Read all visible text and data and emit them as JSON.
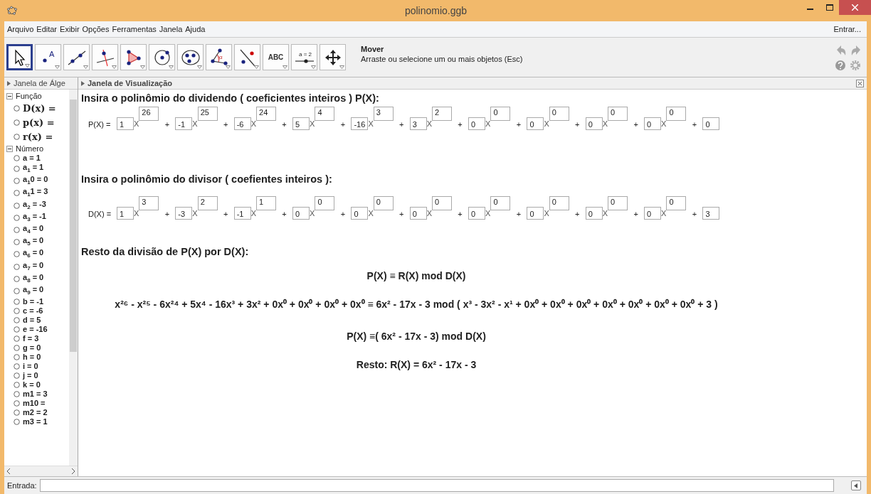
{
  "window": {
    "title": "polinomio.ggb"
  },
  "menu": [
    "Arquivo",
    "Editar",
    "Exibir",
    "Opções",
    "Ferramentas",
    "Janela",
    "Ajuda"
  ],
  "sign_in": "Entrar...",
  "tools": [
    {
      "kind": "move",
      "selected": true
    },
    {
      "kind": "point",
      "label": "A",
      "selected": false
    },
    {
      "kind": "line",
      "selected": false
    },
    {
      "kind": "perpendicular",
      "selected": false
    },
    {
      "kind": "polygon",
      "selected": false
    },
    {
      "kind": "circle",
      "selected": false
    },
    {
      "kind": "conic",
      "selected": false
    },
    {
      "kind": "angle",
      "label": "α",
      "selected": false
    },
    {
      "kind": "reflect",
      "selected": false
    },
    {
      "kind": "text",
      "label": "ABC",
      "selected": false
    },
    {
      "kind": "slider",
      "label": "a = 2",
      "selected": false
    },
    {
      "kind": "pan",
      "selected": false
    }
  ],
  "tool_info": {
    "name": "Mover",
    "hint": "Arraste ou selecione um ou mais objetos (Esc)"
  },
  "algebra": {
    "header": "Janela de Álge",
    "groups": [
      {
        "label": "Função",
        "expanded": true,
        "children": [
          {
            "label": "D(x) ="
          },
          {
            "label": "p(x) ="
          },
          {
            "label": "r(x) ="
          }
        ]
      },
      {
        "label": "Número",
        "expanded": true,
        "children": [
          {
            "label": "a = 1"
          },
          {
            "label": "a$_{1}$ = 1"
          },
          {
            "label": "a$_{1}$0 = 0"
          },
          {
            "label": "a$_{1}$1 = 3"
          },
          {
            "label": "a$_{2}$ = -3"
          },
          {
            "label": "a$_{3}$ = -1"
          },
          {
            "label": "a$_{4}$ = 0"
          },
          {
            "label": "a$_{5}$ = 0"
          },
          {
            "label": "a$_{6}$ = 0"
          },
          {
            "label": "a$_{7}$ = 0"
          },
          {
            "label": "a$_{8}$ = 0"
          },
          {
            "label": "a$_{9}$ = 0"
          },
          {
            "label": "b = -1"
          },
          {
            "label": "c = -6"
          },
          {
            "label": "d = 5"
          },
          {
            "label": "e = -16"
          },
          {
            "label": "f = 3"
          },
          {
            "label": "g = 0"
          },
          {
            "label": "h = 0"
          },
          {
            "label": "i = 0"
          },
          {
            "label": "j = 0"
          },
          {
            "label": "k = 0"
          },
          {
            "label": "m1 = 3"
          },
          {
            "label": "m10 ="
          },
          {
            "label": "m2 = 2"
          },
          {
            "label": "m3 = 1"
          }
        ]
      }
    ]
  },
  "graphics": {
    "header": "Janela de Visualização",
    "dividend": {
      "heading": "Insira o polinômio do dividendo ( coeficientes inteiros ) P(X):",
      "label": "P(X) =",
      "terms": [
        {
          "coef": "1",
          "var": "X",
          "exp": "26"
        },
        {
          "sign": "+",
          "coef": "-1",
          "var": "X",
          "exp": "25"
        },
        {
          "sign": "+",
          "coef": "-6",
          "var": "X",
          "exp": "24"
        },
        {
          "sign": "+",
          "coef": "5",
          "var": "X",
          "exp": "4"
        },
        {
          "sign": "+",
          "coef": "-16",
          "var": "X",
          "exp": "3"
        },
        {
          "sign": "+",
          "coef": "3",
          "var": "X",
          "exp": "2"
        },
        {
          "sign": "+",
          "coef": "0",
          "var": "X",
          "exp": "0"
        },
        {
          "sign": "+",
          "coef": "0",
          "var": "X",
          "exp": "0"
        },
        {
          "sign": "+",
          "coef": "0",
          "var": "X",
          "exp": "0"
        },
        {
          "sign": "+",
          "coef": "0",
          "var": "X",
          "exp": "0"
        },
        {
          "sign": "+",
          "coef": "0"
        }
      ]
    },
    "divisor": {
      "heading": "Insira o polinômio do divisor ( coefientes inteiros ):",
      "label": "D(X) =",
      "terms": [
        {
          "coef": "1",
          "var": "X",
          "exp": "3"
        },
        {
          "sign": "+",
          "coef": "-3",
          "var": "X",
          "exp": "2"
        },
        {
          "sign": "+",
          "coef": "-1",
          "var": "X",
          "exp": "1"
        },
        {
          "sign": "+",
          "coef": "0",
          "var": "X",
          "exp": "0"
        },
        {
          "sign": "+",
          "coef": "0",
          "var": "X",
          "exp": "0"
        },
        {
          "sign": "+",
          "coef": "0",
          "var": "X",
          "exp": "0"
        },
        {
          "sign": "+",
          "coef": "0",
          "var": "X",
          "exp": "0"
        },
        {
          "sign": "+",
          "coef": "0",
          "var": "X",
          "exp": "0"
        },
        {
          "sign": "+",
          "coef": "0",
          "var": "X",
          "exp": "0"
        },
        {
          "sign": "+",
          "coef": "0",
          "var": "X",
          "exp": "0"
        },
        {
          "sign": "+",
          "coef": "3"
        }
      ]
    },
    "result_heading": "Resto da divisão de P(X) por D(X):",
    "results": [
      "P(X) ≡ R(X) mod D(X)",
      "x²⁶ - x²⁵ - 6x²⁴ + 5x⁴ - 16x³ + 3x² + 0x⁰ + 0x⁰ + 0x⁰ + 0x⁰ ≡ 6x² - 17x - 3 mod ( x³ - 3x² - x¹ + 0x⁰ + 0x⁰ + 0x⁰ + 0x⁰ + 0x⁰ + 0x⁰ + 0x⁰ + 3 )",
      "P(X) ≡( 6x² - 17x - 3) mod D(X)",
      "Resto: R(X) = 6x² - 17x - 3"
    ]
  },
  "input_bar": {
    "label": "Entrada:"
  }
}
